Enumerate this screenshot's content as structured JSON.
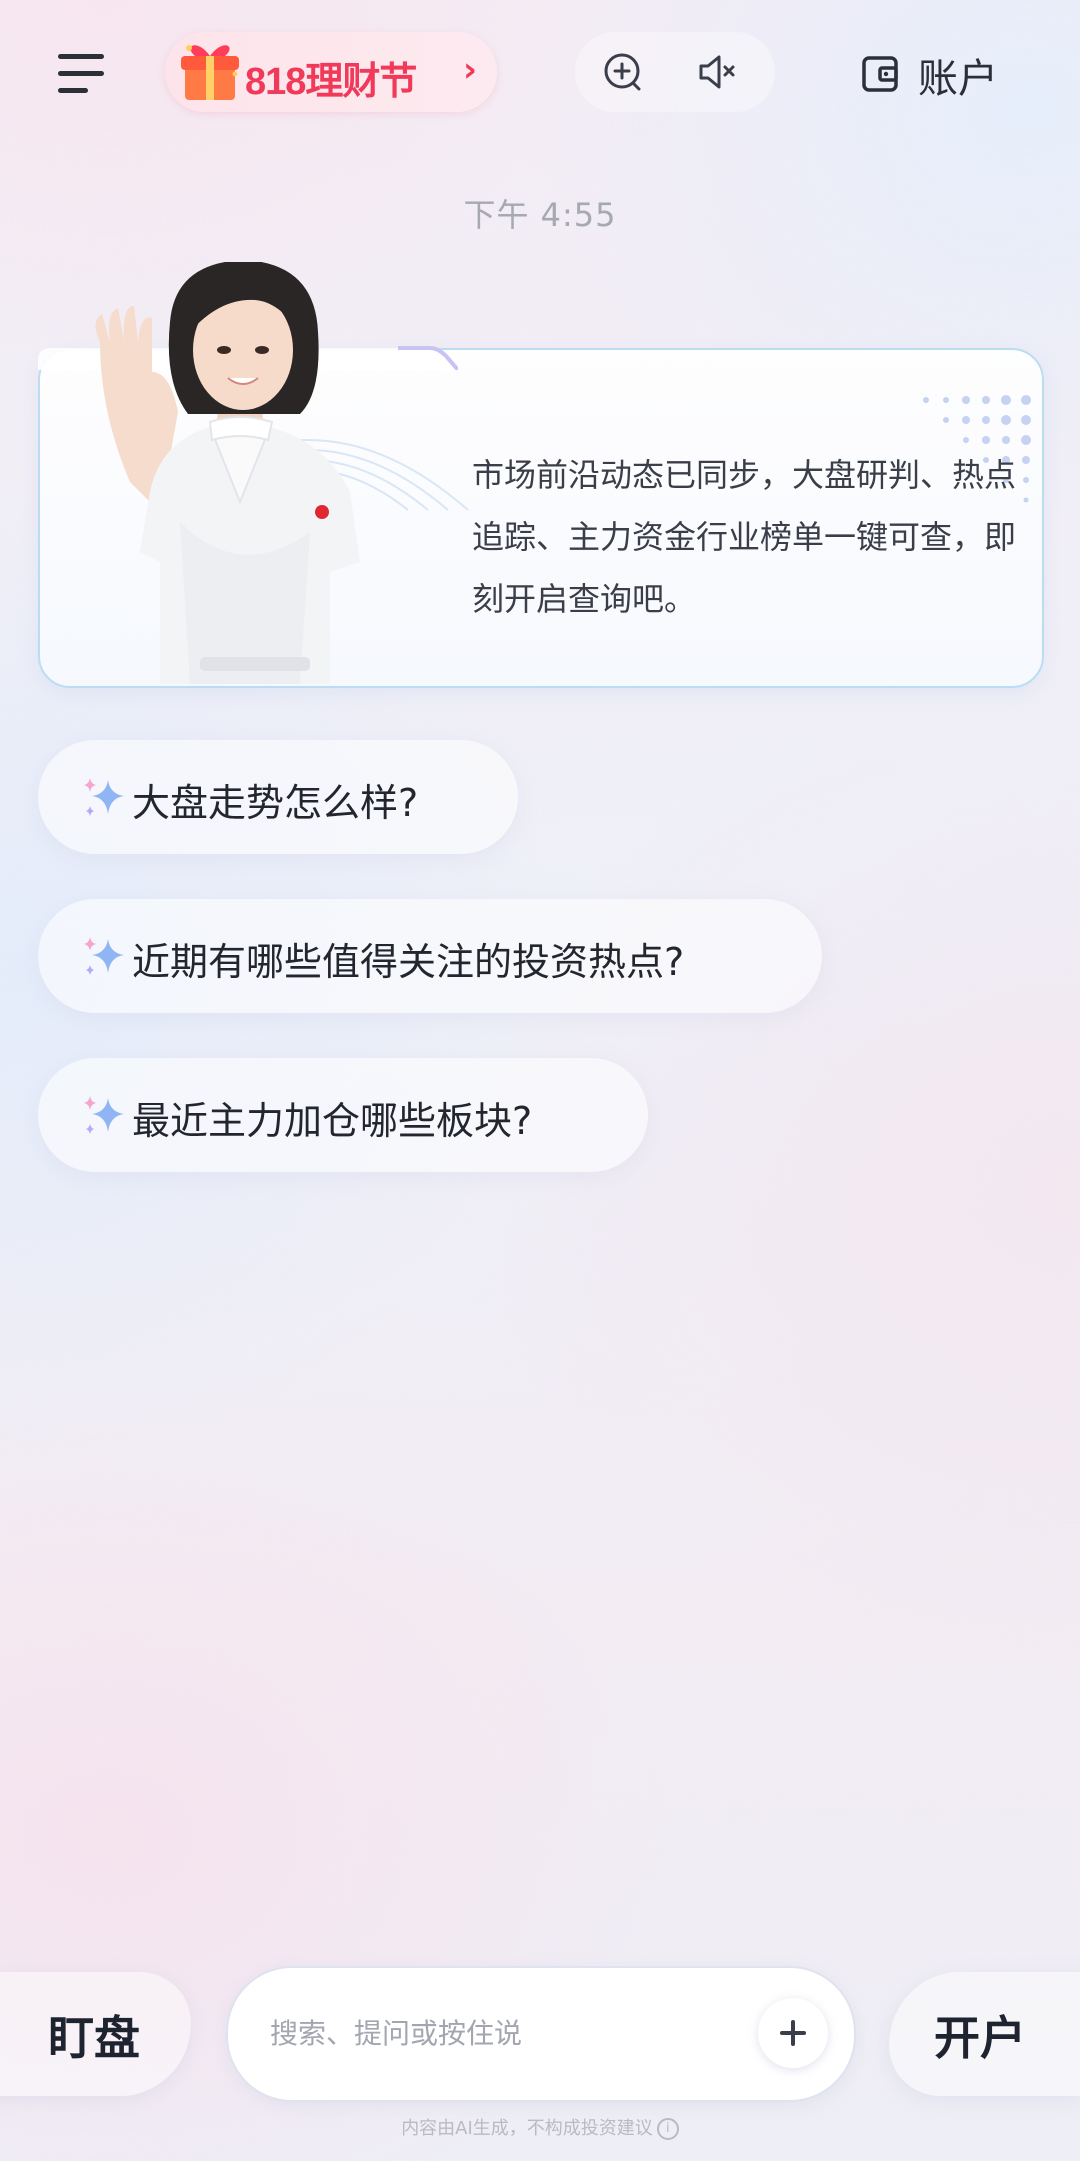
{
  "header": {
    "promo_label": "818理财节",
    "promo_arrow": "›",
    "account_label": "账户",
    "icons": [
      "menu-icon",
      "gift-icon",
      "new-chat-icon",
      "mute-icon",
      "wallet-icon"
    ]
  },
  "chat": {
    "time": "下午 4:55",
    "greeting": "市场前沿动态已同步，大盘研判、热点追踪、主力资金行业榜单一键可查，即刻开启查询吧。"
  },
  "suggestions": [
    {
      "label": "大盘走势怎么样?"
    },
    {
      "label": "近期有哪些值得关注的投资热点?"
    },
    {
      "label": "最近主力加仓哪些板块?"
    }
  ],
  "footer": {
    "left_button": "盯盘",
    "right_button": "开户",
    "input_placeholder": "搜索、提问或按住说",
    "disclaimer": "内容由AI生成，不构成投资建议",
    "info_glyph": "i"
  },
  "colors": {
    "promo_accent": "#f13a5a",
    "card_border": "#bcdcf4",
    "sparkle": "#8fb5f5"
  }
}
